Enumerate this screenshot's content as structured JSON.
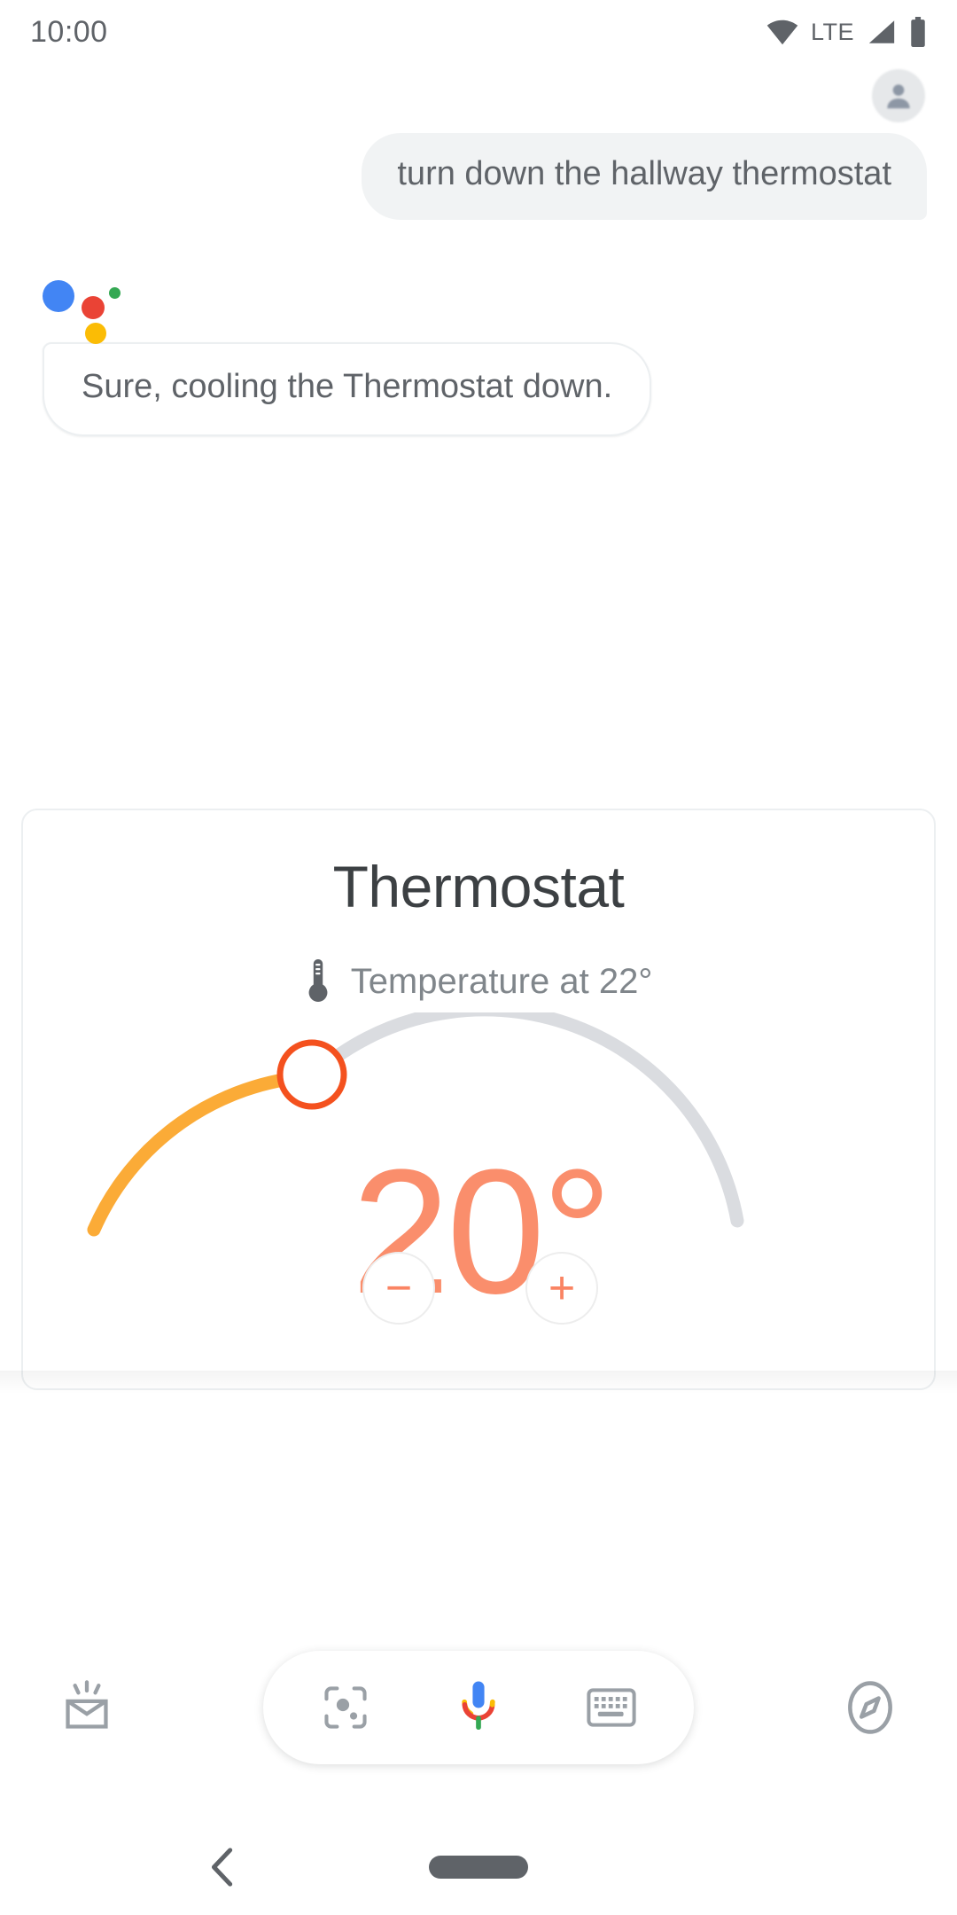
{
  "status_bar": {
    "time": "10:00",
    "network_label": "LTE",
    "icons": [
      "wifi-icon",
      "signal-icon",
      "battery-icon"
    ]
  },
  "conversation": {
    "user": {
      "avatar": "user-avatar",
      "message": "turn down the hallway thermostat"
    },
    "assistant": {
      "logo": "google-assistant-logo",
      "message": "Sure, cooling the Thermostat down."
    }
  },
  "thermostat_card": {
    "title": "Thermostat",
    "status_icon": "thermometer-icon",
    "status_text": "Temperature at 22°",
    "current_temperature": "20°",
    "target_value": 20,
    "ambient_value": 22,
    "decrease_label": "−",
    "increase_label": "+",
    "colors": {
      "arc_active": "#fbab37",
      "arc_track": "#dadce0",
      "handle": "#f4511e",
      "temperature_text": "#fa8e6c",
      "stepper_glyph": "#fa8463"
    }
  },
  "bottom_bar": {
    "left_icon": "snapshot-inbox-icon",
    "right_icon": "explore-compass-icon",
    "pill": {
      "lens_icon": "google-lens-icon",
      "mic_icon": "google-microphone-icon",
      "keyboard_icon": "keyboard-icon"
    }
  },
  "nav_bar": {
    "back_icon": "back-chevron-icon",
    "home_icon": "home-pill-icon"
  }
}
